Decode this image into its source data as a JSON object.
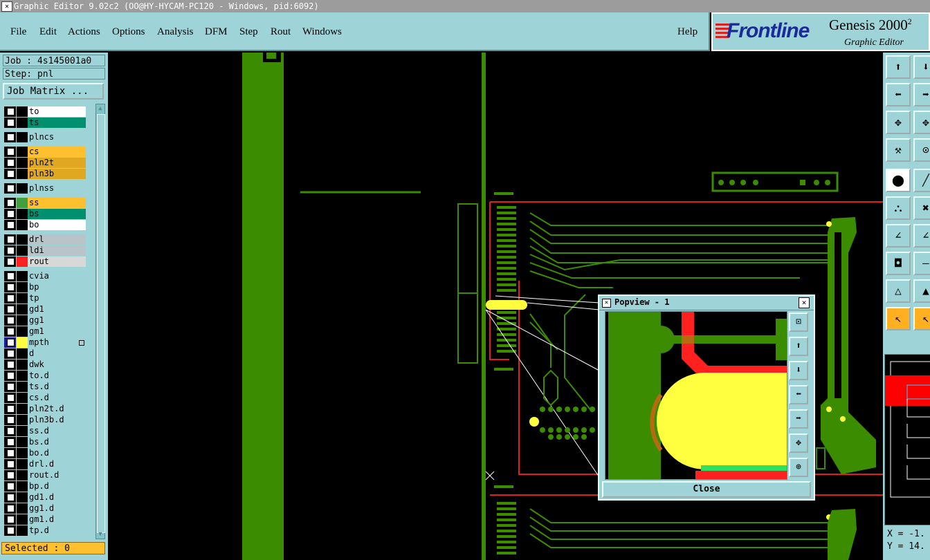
{
  "window": {
    "title": "Graphic Editor 9.02c2 (OO@HY-HYCAM-PC120 - Windows, pid:6092)"
  },
  "menu": {
    "file": "File",
    "edit": "Edit",
    "actions": "Actions",
    "options": "Options",
    "analysis": "Analysis",
    "dfm": "DFM",
    "step": "Step",
    "rout": "Rout",
    "windows": "Windows",
    "help": "Help"
  },
  "logo": {
    "brand": "Frontline",
    "product": "Genesis 2000",
    "product_sup": "2",
    "subtitle": "Graphic Editor"
  },
  "job": {
    "job_label": "Job : 4s145001a0",
    "step_label": "Step: pnl",
    "matrix_button": "Job Matrix ..."
  },
  "layers": [
    {
      "name": "to",
      "bg": "#ffffff",
      "color": "#000000"
    },
    {
      "name": "ts",
      "bg": "#009070",
      "color": "#000000"
    },
    {
      "name": "plncs",
      "bg": "#9ed4d8",
      "color": "#000000"
    },
    {
      "name": "cs",
      "bg": "#ffc030",
      "color": "#000000"
    },
    {
      "name": "pln2t",
      "bg": "#e0a820",
      "color": "#000000"
    },
    {
      "name": "pln3b",
      "bg": "#e0a820",
      "color": "#000000"
    },
    {
      "name": "plnss",
      "bg": "#9ed4d8",
      "color": "#000000"
    },
    {
      "name": "ss",
      "bg": "#ffc030",
      "color": "#40a040"
    },
    {
      "name": "bs",
      "bg": "#009070",
      "color": "#000000"
    },
    {
      "name": "bo",
      "bg": "#ffffff",
      "color": "#000000"
    },
    {
      "name": "drl",
      "bg": "#b8c4c8",
      "color": "#000000"
    },
    {
      "name": "ldi",
      "bg": "#b8c4c8",
      "color": "#000000"
    },
    {
      "name": "rout",
      "bg": "#d8d8d8",
      "color": "#ff2020"
    },
    {
      "name": "cvia",
      "bg": "#9ed4d8",
      "color": "#000000"
    },
    {
      "name": "bp",
      "bg": "#9ed4d8",
      "color": "#000000"
    },
    {
      "name": "tp",
      "bg": "#9ed4d8",
      "color": "#000000"
    },
    {
      "name": "gd1",
      "bg": "#9ed4d8",
      "color": "#000000"
    },
    {
      "name": "gg1",
      "bg": "#9ed4d8",
      "color": "#000000"
    },
    {
      "name": "gm1",
      "bg": "#9ed4d8",
      "color": "#000000"
    },
    {
      "name": "mpth",
      "bg": "#9ed4d8",
      "color": "#ffff40",
      "active": true
    },
    {
      "name": "d",
      "bg": "#9ed4d8",
      "color": "#000000"
    },
    {
      "name": "dwk",
      "bg": "#9ed4d8",
      "color": "#000000"
    },
    {
      "name": "to.d",
      "bg": "#9ed4d8",
      "color": "#000000"
    },
    {
      "name": "ts.d",
      "bg": "#9ed4d8",
      "color": "#000000"
    },
    {
      "name": "cs.d",
      "bg": "#9ed4d8",
      "color": "#000000"
    },
    {
      "name": "pln2t.d",
      "bg": "#9ed4d8",
      "color": "#000000"
    },
    {
      "name": "pln3b.d",
      "bg": "#9ed4d8",
      "color": "#000000"
    },
    {
      "name": "ss.d",
      "bg": "#9ed4d8",
      "color": "#000000"
    },
    {
      "name": "bs.d",
      "bg": "#9ed4d8",
      "color": "#000000"
    },
    {
      "name": "bo.d",
      "bg": "#9ed4d8",
      "color": "#000000"
    },
    {
      "name": "drl.d",
      "bg": "#9ed4d8",
      "color": "#000000"
    },
    {
      "name": "rout.d",
      "bg": "#9ed4d8",
      "color": "#000000"
    },
    {
      "name": "bp.d",
      "bg": "#9ed4d8",
      "color": "#000000"
    },
    {
      "name": "gd1.d",
      "bg": "#9ed4d8",
      "color": "#000000"
    },
    {
      "name": "gg1.d",
      "bg": "#9ed4d8",
      "color": "#000000"
    },
    {
      "name": "gm1.d",
      "bg": "#9ed4d8",
      "color": "#000000"
    },
    {
      "name": "tp.d",
      "bg": "#9ed4d8",
      "color": "#000000"
    }
  ],
  "status": {
    "selected": "Selected : 0"
  },
  "popview": {
    "title": "Popview - 1",
    "close_button": "Close"
  },
  "coords": {
    "x": "X = -1.",
    "y": "Y = 14."
  },
  "colors": {
    "panel": "#9ed4d8",
    "copper_green": "#3c8c00",
    "highlight_yellow": "#ffff40",
    "rout_red": "#ff2020"
  }
}
